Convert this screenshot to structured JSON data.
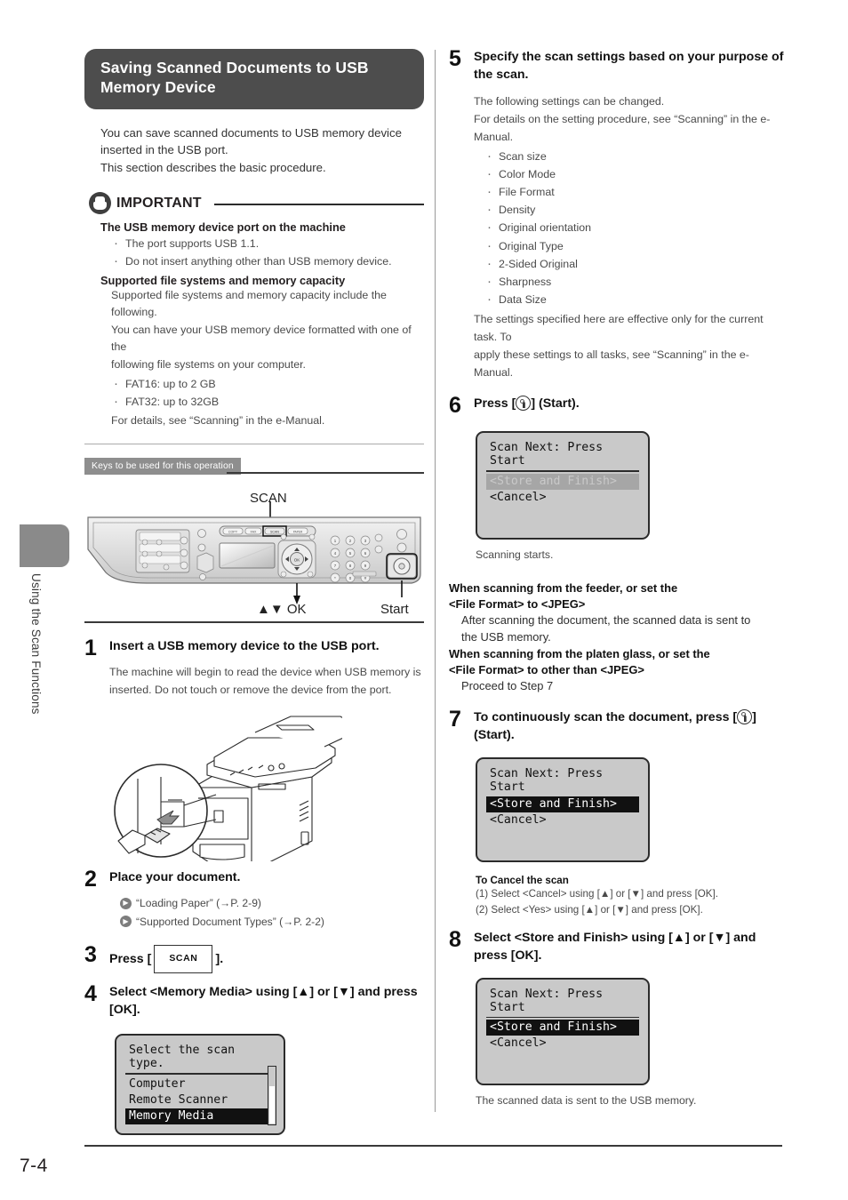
{
  "page": {
    "number": "7-4",
    "side_tab_label": "Using the Scan Functions"
  },
  "section": {
    "title": "Saving Scanned Documents to USB Memory Device",
    "intro_line1": "You can save scanned documents to USB memory device inserted in the USB port.",
    "intro_line2": "This section describes the basic procedure."
  },
  "important": {
    "icon": "hand-stop-icon",
    "label": "IMPORTANT",
    "heading1": "The USB memory device port on the machine",
    "bullets1": [
      "The port supports USB 1.1.",
      "Do not insert anything other than USB memory device."
    ],
    "heading2": "Supported file systems and memory capacity",
    "para2_line1": "Supported file systems and memory capacity include the following.",
    "para2_line2": "You can have your USB memory device formatted with one of the",
    "para2_line3": "following file systems on your computer.",
    "bullets2": [
      "FAT16: up to 2 GB",
      "FAT32: up to 32GB"
    ],
    "footer": "For details, see “Scanning” in the e-Manual."
  },
  "keys_figure": {
    "tag": "Keys to be used for this operation",
    "callout_top": "SCAN",
    "callout_left": "▲▼ OK",
    "callout_right": "Start"
  },
  "steps_left": [
    {
      "num": "1",
      "title": "Insert a USB memory device to the USB port.",
      "text_line1": "The machine will begin to read the device when USB memory is",
      "text_line2": "inserted. Do not touch or remove the device from the port."
    },
    {
      "num": "2",
      "title": "Place your document.",
      "refs": [
        "“Loading Paper” (→P. 2-9)",
        "“Supported Document Types” (→P. 2-2)"
      ]
    },
    {
      "num": "3",
      "title_pre": "Press [",
      "key_label": "SCAN",
      "title_post": "]."
    },
    {
      "num": "4",
      "title": "Select <Memory Media> using [▲] or [▼] and press [OK]."
    }
  ],
  "lcd_step4": {
    "title": "Select the scan type.",
    "rows": [
      {
        "text": "Computer",
        "state": "normal"
      },
      {
        "text": "Remote Scanner",
        "state": "normal"
      },
      {
        "text": "Memory Media",
        "state": "selected"
      }
    ],
    "has_scrollbar": true
  },
  "steps_right": [
    {
      "num": "5",
      "title": "Specify the scan settings based on your purpose of the scan.",
      "text_line1": "The following settings can be changed.",
      "text_line2": "For details on the setting procedure, see “Scanning” in the e-Manual.",
      "settings": [
        "Scan size",
        "Color Mode",
        "File Format",
        "Density",
        "Original orientation",
        "Original Type",
        "2-Sided Original",
        "Sharpness",
        "Data Size"
      ],
      "tail_line1": "The settings specified here are effective only for the current task. To",
      "tail_line2": "apply these settings to all tasks, see “Scanning” in the e-Manual."
    },
    {
      "num": "6",
      "title_pre": "Press [",
      "icon": "start-button-icon",
      "title_post": "] (Start).",
      "note": "Scanning starts."
    },
    {
      "num": "7",
      "title_pre": "To continuously scan the document, press [",
      "icon": "start-button-icon",
      "title_post": "] (Start)."
    },
    {
      "num": "8",
      "title": "Select <Store and Finish> using [▲] or [▼] and press [OK].",
      "note": "The scanned data is sent to the USB memory."
    }
  ],
  "lcd_step6": {
    "title": "Scan Next: Press Start",
    "rows": [
      {
        "text": "<Store and Finish>",
        "state": "dimmed"
      },
      {
        "text": "<Cancel>",
        "state": "normal"
      }
    ]
  },
  "lcd_step7": {
    "title": "Scan Next: Press Start",
    "rows": [
      {
        "text": "<Store and Finish>",
        "state": "selected"
      },
      {
        "text": "<Cancel>",
        "state": "normal"
      }
    ]
  },
  "lcd_step8": {
    "title": "Scan Next: Press Start",
    "rows": [
      {
        "text": "<Store and Finish>",
        "state": "selected"
      },
      {
        "text": "<Cancel>",
        "state": "normal"
      }
    ]
  },
  "feeder_note": {
    "heading_line1": "When scanning from the feeder, or set the",
    "heading_line2": "<File Format> to <JPEG>",
    "body_line1": "After scanning the document, the scanned data is sent to",
    "body_line2": "the USB memory.",
    "heading2_line1": "When scanning from the platen glass, or set the",
    "heading2_line2": "<File Format> to other than <JPEG>",
    "body2": "Proceed to Step 7"
  },
  "cancel_block": {
    "heading": "To Cancel the scan",
    "items": [
      "(1)  Select <Cancel> using [▲] or [▼] and press [OK].",
      "(2)  Select <Yes> using [▲] or [▼] and press [OK]."
    ]
  },
  "colors": {
    "header_bg": "#4d4d4d",
    "tag_bg": "#8e8e8e",
    "lcd_bg": "#c9c9c9",
    "lcd_selected_bg": "#111111",
    "side_tab": "#8a8a8a"
  }
}
